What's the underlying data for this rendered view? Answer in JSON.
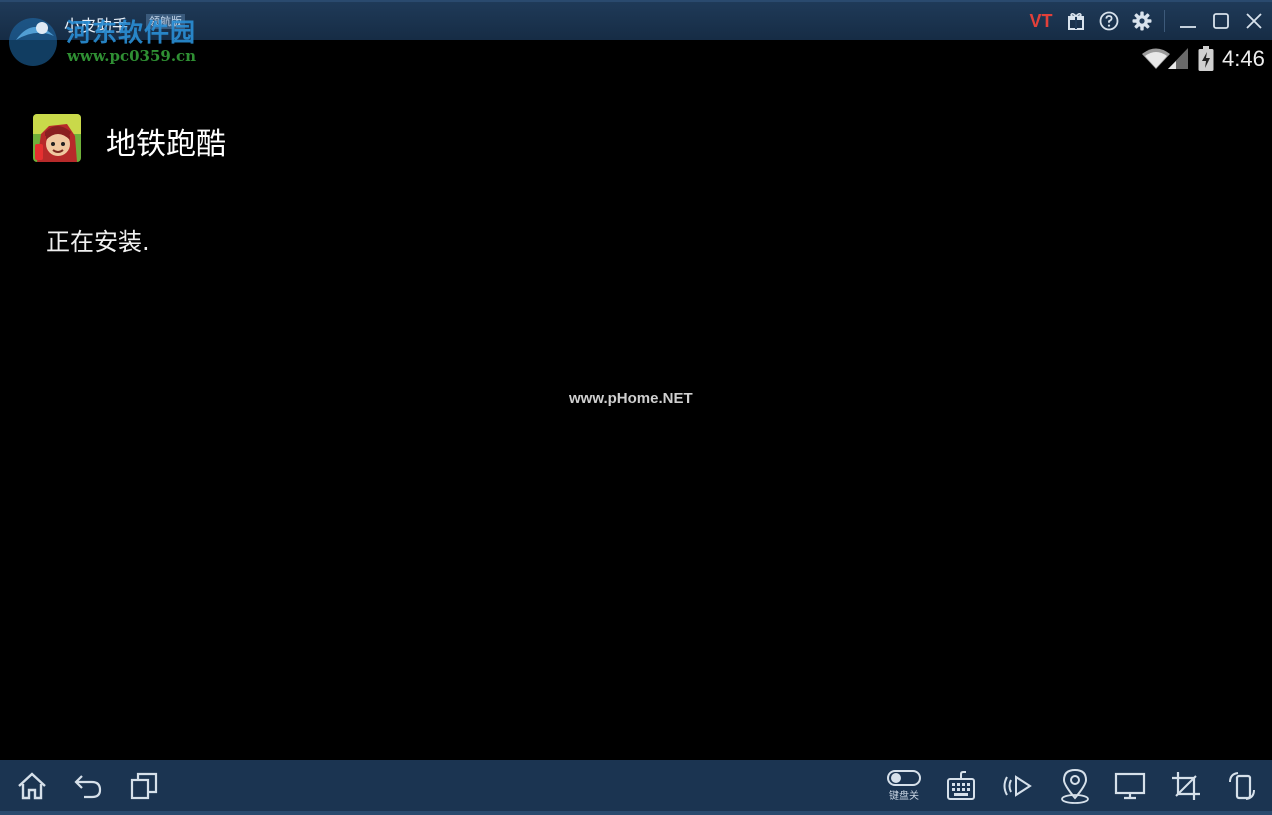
{
  "window": {
    "app_name": "小皮助手",
    "edition_badge": "领航版",
    "watermark_site": "河东软件园",
    "watermark_url": "www.pc0359.cn",
    "controls": {
      "vt_label": "VT",
      "icons": [
        "gift-icon",
        "help-icon",
        "settings-icon",
        "minimize-icon",
        "maximize-icon",
        "close-icon"
      ]
    }
  },
  "status_bar": {
    "time": "4:46",
    "icons": [
      "wifi-icon",
      "signal-icon",
      "battery-icon"
    ]
  },
  "installer": {
    "app_title": "地铁跑酷",
    "status_text": "正在安装."
  },
  "center_watermark": "www.pHome.NET",
  "bottom_bar": {
    "left_icons": [
      "home-icon",
      "back-icon",
      "recent-apps-icon"
    ],
    "keyboard_toggle_label": "键盘关",
    "right_icons": [
      "keyboard-icon",
      "shake-icon",
      "location-icon",
      "screen-icon",
      "crop-icon",
      "rotate-icon"
    ]
  },
  "colors": {
    "titlebar": "#1f3a58",
    "bottombar": "#1b3451",
    "vt_red": "#e2403a",
    "background": "#000000"
  }
}
